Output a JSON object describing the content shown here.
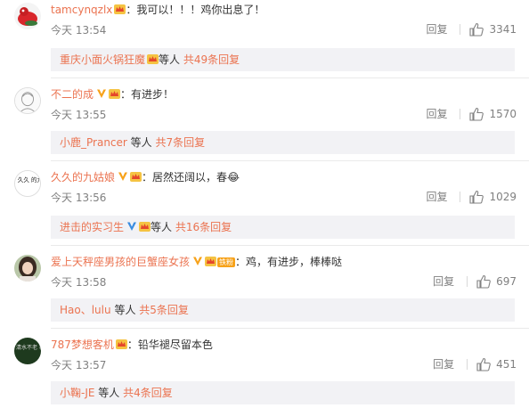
{
  "comments": [
    {
      "username": "tamcynqzlx",
      "has_v": false,
      "has_crown": true,
      "has_fan": false,
      "text": "我可以！！！鸡你出息了！",
      "time": "今天 13:54",
      "reply_label": "回复",
      "likes": "3341",
      "sub_name": "重庆小面火锅狂魔",
      "sub_crown": true,
      "sub_v": false,
      "sub_mid": "等人",
      "sub_count": "共49条回复"
    },
    {
      "username": "不二的成",
      "has_v": true,
      "has_crown": true,
      "has_fan": false,
      "text": "有进步！",
      "time": "今天 13:55",
      "reply_label": "回复",
      "likes": "1570",
      "sub_name": "小鹿_Prancer",
      "sub_crown": false,
      "sub_v": false,
      "sub_mid": "等人",
      "sub_count": "共7条回复"
    },
    {
      "username": "久久的九姑娘",
      "has_v": true,
      "has_crown": true,
      "has_fan": false,
      "text": "居然还阔以，春😂",
      "time": "今天 13:56",
      "reply_label": "回复",
      "likes": "1029",
      "sub_name": "进击的实习生",
      "sub_crown": true,
      "sub_v": true,
      "sub_mid": "等人",
      "sub_count": "共16条回复"
    },
    {
      "username": "爱上天秤座男孩的巨蟹座女孩",
      "has_v": true,
      "has_crown": true,
      "has_fan": true,
      "fan_label": "铁粉",
      "text": "鸡，有进步，棒棒哒",
      "time": "今天 13:58",
      "reply_label": "回复",
      "likes": "697",
      "sub_name": "Hao、lulu",
      "sub_crown": false,
      "sub_v": false,
      "sub_mid": "等人",
      "sub_count": "共5条回复"
    },
    {
      "username": "787梦想客机",
      "has_v": false,
      "has_crown": true,
      "has_fan": false,
      "text": "铅华褪尽留本色",
      "time": "今天 13:57",
      "reply_label": "回复",
      "likes": "451",
      "sub_name": "小鞠-JE",
      "sub_crown": false,
      "sub_v": false,
      "sub_mid": "等人",
      "sub_count": "共4条回复"
    }
  ],
  "colors": {
    "username": "#eb7350",
    "text": "#333333",
    "meta": "#808080",
    "sub_bg": "#f2f2f5",
    "v_badge": "#f7a21a",
    "crown": "#e74c3c"
  },
  "avatar_icons": [
    "red-creature-avatar-icon",
    "sketch-face-avatar-icon",
    "calligraphy-avatar-icon",
    "girl-photo-avatar-icon",
    "calligraphy-dark-avatar-icon"
  ],
  "avatar_texts": [
    "",
    "",
    "久久 的九姑娘",
    "",
    "清水不老 积水不衰"
  ]
}
